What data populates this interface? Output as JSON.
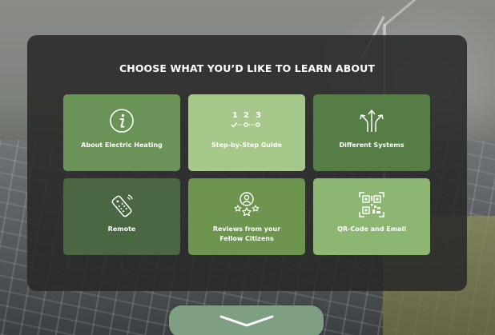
{
  "title": "CHOOSE WHAT YOU’D LIKE TO LEARN ABOUT",
  "tiles": [
    {
      "label": "About Electric Heating",
      "icon": "info-icon",
      "color": "#6b9358"
    },
    {
      "label": "Step-by-Step Guide",
      "icon": "steps-icon",
      "color": "#a7c88b"
    },
    {
      "label": "Different Systems",
      "icon": "branching-arrows-icon",
      "color": "#557d45"
    },
    {
      "label": "Remote",
      "icon": "remote-control-icon",
      "color": "#4a6643"
    },
    {
      "label": "Reviews from your Fellow Citizens",
      "icon": "reviews-icon",
      "color": "#6e954f"
    },
    {
      "label": "QR-Code and Email",
      "icon": "qr-code-icon",
      "color": "#8cb671"
    }
  ],
  "next_button": {
    "icon": "chevron-down-icon",
    "color": "#7f9f83"
  }
}
